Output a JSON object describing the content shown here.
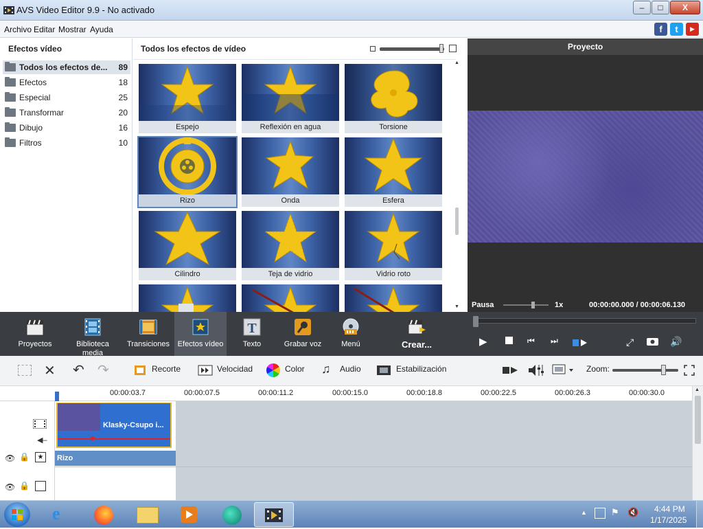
{
  "window": {
    "title": "AVS Video Editor 9.9 - No activado",
    "minimize_glyph": "–",
    "maximize_glyph": "□",
    "close_glyph": "X"
  },
  "menu": {
    "items": [
      "Archivo",
      "Editar",
      "Mostrar",
      "Ayuda"
    ],
    "social": [
      {
        "icon": "facebook-icon",
        "glyph": "f",
        "color": "#3b5998"
      },
      {
        "icon": "twitter-icon",
        "glyph": "t",
        "color": "#1da1f2"
      },
      {
        "icon": "youtube-icon",
        "glyph": "▶",
        "color": "#d62a1e"
      }
    ]
  },
  "categories": {
    "header": "Efectos vídeo",
    "items": [
      {
        "label": "Todos los efectos de...",
        "count": "89",
        "selected": true
      },
      {
        "label": "Efectos",
        "count": "18"
      },
      {
        "label": "Especial",
        "count": "25"
      },
      {
        "label": "Transformar",
        "count": "20"
      },
      {
        "label": "Dibujo",
        "count": "16"
      },
      {
        "label": "Filtros",
        "count": "10"
      }
    ]
  },
  "effects": {
    "header": "Todos los efectos de vídeo",
    "tiles": [
      {
        "caption": "Espejo"
      },
      {
        "caption": "Reflexión en agua"
      },
      {
        "caption": "Torsione"
      },
      {
        "caption": "Rizo",
        "selected": true
      },
      {
        "caption": "Onda"
      },
      {
        "caption": "Esfera"
      },
      {
        "caption": "Cilindro"
      },
      {
        "caption": "Teja de vidrio"
      },
      {
        "caption": "Vidrio roto"
      },
      {
        "caption": ""
      },
      {
        "caption": ""
      },
      {
        "caption": ""
      }
    ]
  },
  "preview": {
    "header": "Proyecto",
    "state": "Pausa",
    "speed": "1x",
    "time": "00:00:00.000 / 00:00:06.130"
  },
  "main_toolbar": [
    {
      "label": "Proyectos",
      "icon": "clapper-icon"
    },
    {
      "label": "Biblioteca media",
      "icon": "film-strip-icon"
    },
    {
      "label": "Transiciones",
      "icon": "transition-icon"
    },
    {
      "label": "Efectos vídeo",
      "icon": "star-effect-icon",
      "active": true
    },
    {
      "label": "Texto",
      "icon": "text-t-icon"
    },
    {
      "label": "Grabar voz",
      "icon": "microphone-icon"
    },
    {
      "label": "Menú",
      "icon": "disc-menu-icon"
    },
    {
      "label": "Crear...",
      "icon": "create-clapper-icon"
    }
  ],
  "edit_toolbar": {
    "recorte": "Recorte",
    "velocidad": "Velocidad",
    "color": "Color",
    "audio": "Audio",
    "estabilizacion": "Estabilización",
    "zoom_label": "Zoom:"
  },
  "ruler": {
    "ticks": [
      "00:00:03.7",
      "00:00:07.5",
      "00:00:11.2",
      "00:00:15.0",
      "00:00:18.8",
      "00:00:22.5",
      "00:00:26.3",
      "00:00:30.0"
    ]
  },
  "timeline": {
    "clip_label": "Klasky-Csupo i...",
    "effect_label": "Rizo"
  },
  "taskbar": {
    "time": "4:44 PM",
    "date": "1/17/2025"
  }
}
